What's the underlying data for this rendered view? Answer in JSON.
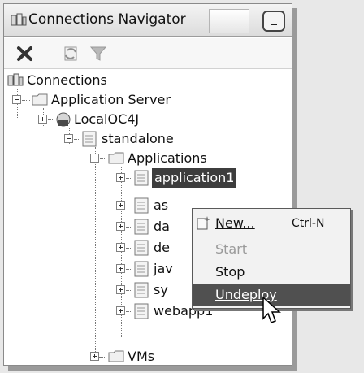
{
  "panel": {
    "title": "Connections Navigator"
  },
  "toolbar": {
    "delete_icon": "x-icon",
    "refresh_icon": "refresh-icon",
    "filter_icon": "filter-icon"
  },
  "tree": {
    "root_label": "Connections",
    "app_server_label": "Application Server",
    "oc4j_label": "LocalOC4J",
    "standalone_label": "standalone",
    "applications_label": "Applications",
    "apps": [
      {
        "label": "application1"
      },
      {
        "label": "as"
      },
      {
        "label": "da"
      },
      {
        "label": "de"
      },
      {
        "label": "jav"
      },
      {
        "label": "sy"
      },
      {
        "label": "webapp1"
      }
    ],
    "vms_label": "VMs"
  },
  "context_menu": {
    "new_label": "New...",
    "new_shortcut": "Ctrl-N",
    "start_label": "Start",
    "stop_label": "Stop",
    "undeploy_label": "Undeploy"
  },
  "colors": {
    "selection": "#3d3d3d",
    "menu_hover": "#505050"
  }
}
